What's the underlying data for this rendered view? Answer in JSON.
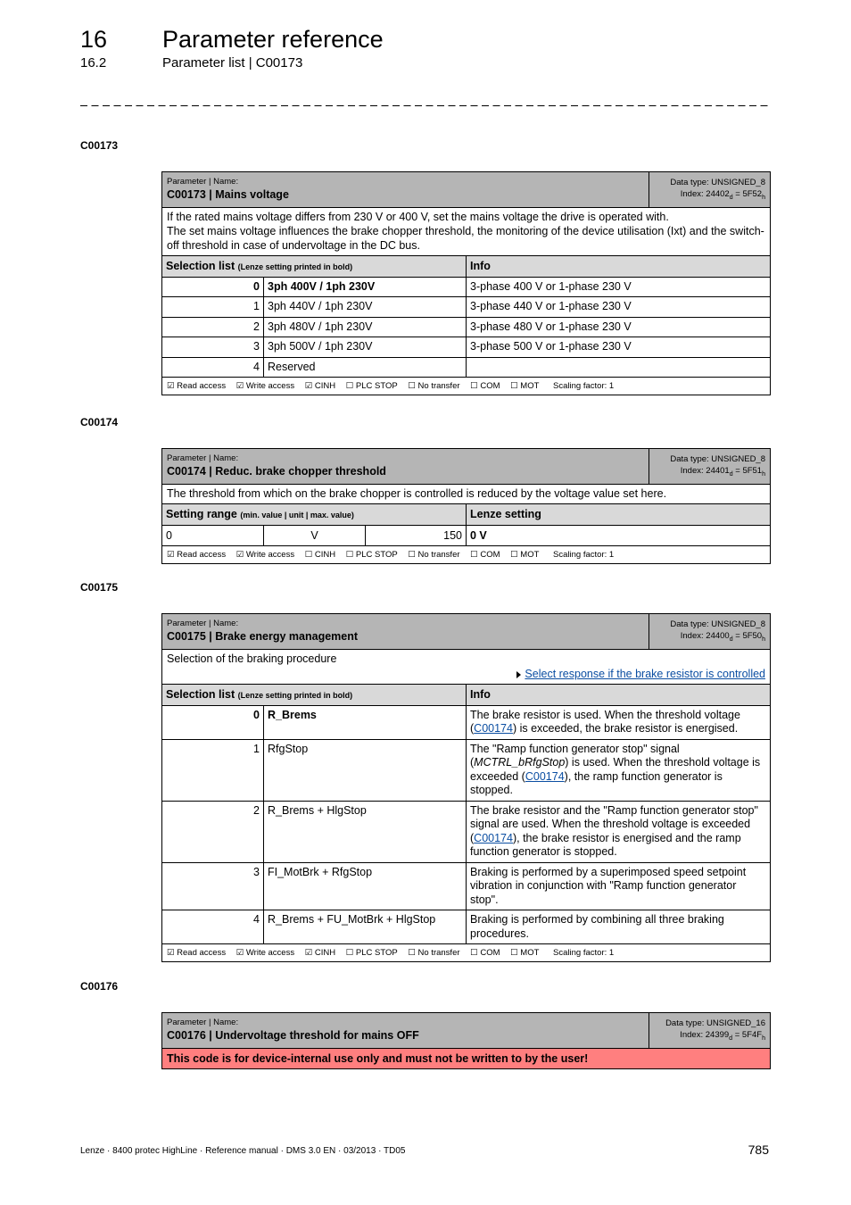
{
  "header": {
    "chapter_num": "16",
    "chapter_title": "Parameter reference",
    "section_num": "16.2",
    "section_title": "Parameter list | C00173"
  },
  "common": {
    "param_name_label": "Parameter | Name:",
    "selection_list_label": "Selection list",
    "selection_list_note": "(Lenze setting printed in bold)",
    "info_label": "Info",
    "setting_range_label": "Setting range",
    "setting_range_note": "(min. value | unit | max. value)",
    "lenze_setting_label": "Lenze setting"
  },
  "c00173": {
    "heading": "C00173",
    "name": "C00173 | Mains voltage",
    "data_type": "Data type: UNSIGNED_8",
    "index_dec": "24402",
    "index_hex": "5F52",
    "description_lines": [
      "If the rated mains voltage differs from 230 V or 400 V, set the mains voltage the drive is operated with.",
      "The set mains voltage influences the brake chopper threshold, the monitoring of the device utilisation (Ixt) and the switch-off threshold in case of undervoltage in the DC bus."
    ],
    "rows": [
      {
        "value": "0",
        "name": "3ph 400V / 1ph 230V",
        "info": "3-phase 400 V or 1-phase 230 V",
        "bold": true
      },
      {
        "value": "1",
        "name": "3ph 440V / 1ph 230V",
        "info": "3-phase 440 V or 1-phase 230 V"
      },
      {
        "value": "2",
        "name": "3ph 480V / 1ph 230V",
        "info": "3-phase 480 V or 1-phase 230 V"
      },
      {
        "value": "3",
        "name": "3ph 500V / 1ph 230V",
        "info": "3-phase 500 V or 1-phase 230 V"
      },
      {
        "value": "4",
        "name": "Reserved",
        "info": ""
      }
    ],
    "access": [
      "☑ Read access",
      "☑ Write access",
      "☑ CINH",
      "☐ PLC STOP",
      "☐ No transfer",
      "☐ COM",
      "☐ MOT"
    ],
    "scaling": "Scaling factor: 1"
  },
  "c00174": {
    "heading": "C00174",
    "name": "C00174 | Reduc. brake chopper threshold",
    "data_type": "Data type: UNSIGNED_8",
    "index_dec": "24401",
    "index_hex": "5F51",
    "description": "The threshold from which on the brake chopper is controlled is reduced by the voltage value set here.",
    "range": {
      "min": "0",
      "unit": "V",
      "max": "150",
      "lenze_setting": "0 V"
    },
    "access": [
      "☑ Read access",
      "☑ Write access",
      "☐ CINH",
      "☐ PLC STOP",
      "☐ No transfer",
      "☐ COM",
      "☐ MOT"
    ],
    "scaling": "Scaling factor: 1"
  },
  "c00175": {
    "heading": "C00175",
    "name": "C00175 | Brake energy management",
    "data_type": "Data type: UNSIGNED_8",
    "index_dec": "24400",
    "index_hex": "5F50",
    "description": "Selection of the braking procedure",
    "link": "Select response if the brake resistor is controlled",
    "rows": [
      {
        "value": "0",
        "name": "R_Brems",
        "bold": true,
        "info_parts": [
          "The brake resistor is used. When the threshold voltage (",
          "C00174",
          ") is exceeded, the brake resistor is energised."
        ]
      },
      {
        "value": "1",
        "name": "RfgStop",
        "info_parts": [
          "The \"Ramp function generator stop\" signal (",
          "MCTRL_bRfgStop",
          ") is used. When the threshold voltage is exceeded (",
          "C00174",
          "), the ramp function generator is stopped."
        ]
      },
      {
        "value": "2",
        "name": "R_Brems + HlgStop",
        "info_parts": [
          "The brake resistor and the \"Ramp function generator stop\" signal are used. When the threshold voltage is exceeded (",
          "C00174",
          "), the brake resistor is energised and the ramp function generator is stopped."
        ]
      },
      {
        "value": "3",
        "name": "FI_MotBrk + RfgStop",
        "info": "Braking is performed by a superimposed speed setpoint vibration in conjunction with \"Ramp function generator stop\"."
      },
      {
        "value": "4",
        "name": "R_Brems + FU_MotBrk + HlgStop",
        "info": "Braking is performed by combining all three braking procedures."
      }
    ],
    "access": [
      "☑ Read access",
      "☑ Write access",
      "☑ CINH",
      "☐ PLC STOP",
      "☐ No transfer",
      "☐ COM",
      "☐ MOT"
    ],
    "scaling": "Scaling factor: 1"
  },
  "c00176": {
    "heading": "C00176",
    "name": "C00176 | Undervoltage threshold for mains OFF",
    "data_type": "Data type: UNSIGNED_16",
    "index_dec": "24399",
    "index_hex": "5F4F",
    "warning": "This code is for device-internal use only and must not be written to by the user!",
    "warning_color": "#ff7f7f"
  },
  "footer": {
    "doc_info": "Lenze · 8400 protec HighLine · Reference manual · DMS 3.0 EN · 03/2013 · TD05",
    "page_number": "785"
  }
}
